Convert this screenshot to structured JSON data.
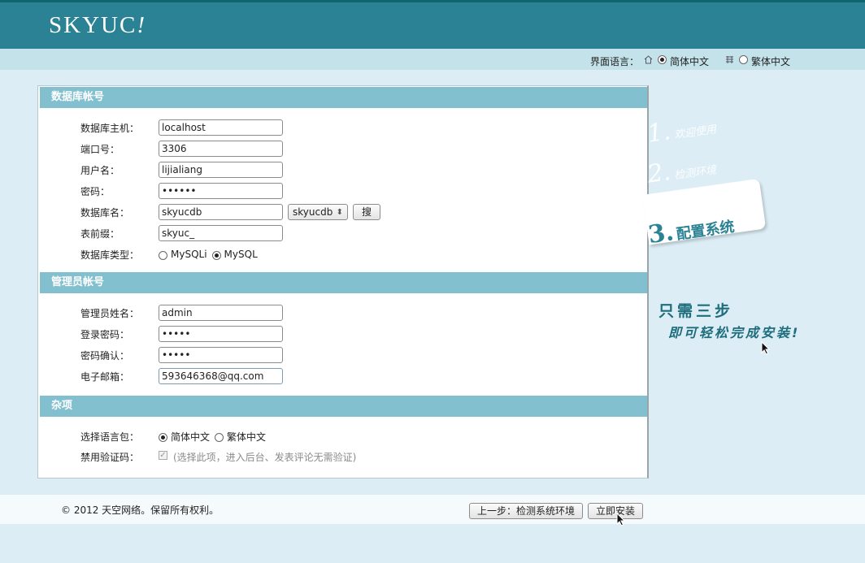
{
  "brand": {
    "logo": "SKYUC",
    "logo_mark": "!"
  },
  "lang_bar": {
    "label": "界面语言：",
    "options": [
      {
        "label": "简体中文",
        "selected": true
      },
      {
        "label": "繁体中文",
        "selected": false
      }
    ]
  },
  "db_section": {
    "title": "数据库帐号",
    "host_label": "数据库主机：",
    "host": "localhost",
    "port_label": "端口号：",
    "port": "3306",
    "user_label": "用户名：",
    "user": "lijialiang",
    "pass_label": "密码：",
    "pass": "••••••",
    "dbname_label": "数据库名：",
    "dbname": "skyucdb",
    "dbname_select": "skyucdb",
    "search_button": "搜",
    "prefix_label": "表前缀：",
    "prefix": "skyuc_",
    "type_label": "数据库类型：",
    "types": [
      {
        "label": "MySQLi",
        "selected": false
      },
      {
        "label": "MySQL",
        "selected": true
      }
    ]
  },
  "admin_section": {
    "title": "管理员帐号",
    "name_label": "管理员姓名：",
    "name": "admin",
    "pass_label": "登录密码：",
    "pass": "•••••",
    "confirm_label": "密码确认：",
    "confirm": "•••••",
    "email_label": "电子邮箱：",
    "email": "593646368@qq.com"
  },
  "misc_section": {
    "title": "杂项",
    "lang_label": "选择语言包：",
    "langs": [
      {
        "label": "简体中文",
        "selected": true
      },
      {
        "label": "繁体中文",
        "selected": false
      }
    ],
    "captcha_label": "禁用验证码：",
    "captcha_hint": "(选择此项，进入后台、发表评论无需验证)"
  },
  "steps": {
    "s1_num": "1.",
    "s1_text": "欢迎使用",
    "s2_num": "2.",
    "s2_text": "检测环境",
    "s3_num": "3.",
    "s3_text": "配置系统",
    "slogan1": "只需三步",
    "slogan2": "即可轻松完成安装!"
  },
  "footer": {
    "copyright": "© 2012 天空网络。保留所有权利。",
    "prev_button": "上一步：检测系统环境",
    "install_button": "立即安装"
  },
  "colors": {
    "header": "#2a8294",
    "section": "#82bfcf",
    "background": "#dcedf5"
  }
}
